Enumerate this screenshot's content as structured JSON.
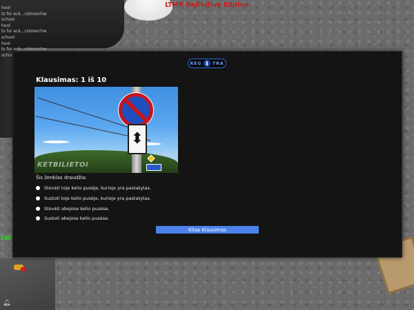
{
  "server": {
    "title": "LTMP Definitive Edition"
  },
  "chat": {
    "lines": [
      "hool",
      "ts for eck...rstmerchw",
      "school",
      "hool",
      "ts for eck...rstmerchw",
      "school",
      "hool",
      "ts for eck...rstmerchw",
      "school"
    ]
  },
  "hud": {
    "number": "100",
    "bell_icon": "bell-icon"
  },
  "dialog": {
    "logo": {
      "left": "REG",
      "right": "TRA"
    },
    "question_title": "Klausimas: 1 iš 10",
    "photo": {
      "watermark": "KETBILIETOI",
      "sign_icon": "arrow-up-down-icon"
    },
    "prompt": "Šis ženklas draudžia:",
    "answers": [
      {
        "label": "Stovėti toje kelio pusėje, kurioje yra pastatytas."
      },
      {
        "label": "Sustoti toje kelio pusėje, kurioje yra pastatytas."
      },
      {
        "label": "Stovėti abejose kelio pusėse."
      },
      {
        "label": "Sustoti abejose kelio pusėse."
      }
    ],
    "next_button": "Kitas Klausimas",
    "colors": {
      "accent": "#4c82ea",
      "dialog_bg": "#141414",
      "server_title": "#d01818"
    }
  }
}
